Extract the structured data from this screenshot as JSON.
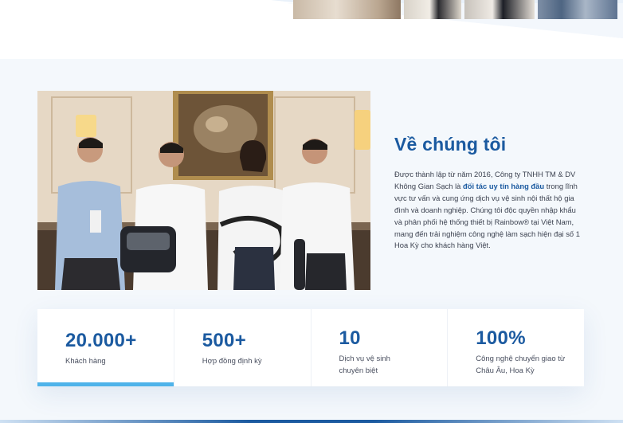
{
  "about": {
    "title": "Về chúng tôi",
    "text_before": "Được thành lập từ năm 2016, Công ty TNHH TM & DV Không Gian Sạch là ",
    "text_highlight": "đối tác uy tín hàng đầu",
    "text_after": " trong lĩnh vực tư vấn và cung ứng dịch vụ vệ sinh nội thất hộ gia đình và doanh nghiệp. Chúng tôi độc quyền nhập khẩu và phân phối hệ thống thiết bị Rainbow® tại Việt Nam, mang đến trải nghiệm công nghệ làm sạch hiện đại số 1 Hoa Kỳ cho khách hàng Việt."
  },
  "stats": [
    {
      "value": "20.000+",
      "label": "Khách hàng"
    },
    {
      "value": "500+",
      "label": "Hợp đồng định kỳ"
    },
    {
      "value": "10",
      "label": "Dịch vụ vệ sinh chuyên biệt"
    },
    {
      "value": "100%",
      "label": "Công nghệ chuyển giao từ Châu Âu, Hoa Kỳ"
    }
  ],
  "colors": {
    "brand_blue": "#1b5aa0",
    "accent_light_blue": "#4fb3ea",
    "page_background": "#f4f8fc"
  },
  "images": {
    "hero_strip": "photo-strip",
    "team_photo": "team-with-vacuum-cleaners-photo"
  }
}
